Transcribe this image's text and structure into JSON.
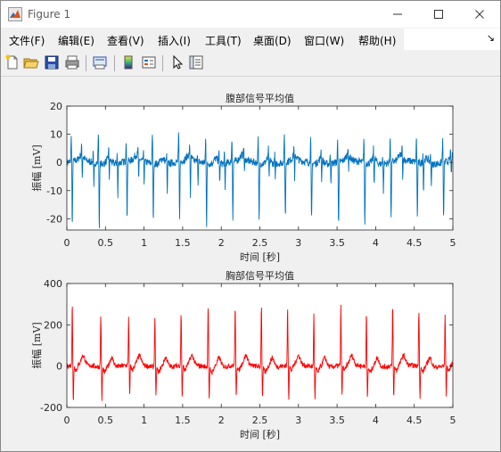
{
  "window": {
    "title": "Figure 1"
  },
  "menu": {
    "items": [
      "文件(F)",
      "编辑(E)",
      "查看(V)",
      "插入(I)",
      "工具(T)",
      "桌面(D)",
      "窗口(W)",
      "帮助(H)"
    ],
    "overflow_icon": "arrow-corner-icon"
  },
  "toolbar": {
    "icons": [
      "new-figure-icon",
      "open-file-icon",
      "save-icon",
      "print-icon",
      "print-preview-icon",
      "colorbar-icon",
      "legend-icon",
      "pointer-icon",
      "property-inspector-icon"
    ]
  },
  "colors": {
    "abdominal_line": "#0072bd",
    "thoracic_line": "#ff0000",
    "axes_bg": "#ffffff",
    "axis_text": "#262626"
  },
  "chart_data": [
    {
      "type": "line",
      "title": "腹部信号平均值",
      "xlabel": "时间 [秒]",
      "ylabel": "振幅 [mV]",
      "xlim": [
        0,
        5
      ],
      "ylim": [
        -24,
        20
      ],
      "xticks": [
        "0",
        "0.5",
        "1",
        "1.5",
        "2",
        "2.5",
        "3",
        "3.5",
        "4",
        "4.5",
        "5"
      ],
      "yticks": [
        "-20",
        "-10",
        "0",
        "10",
        "20"
      ],
      "grid": false,
      "series": [
        {
          "color": "#0072bd",
          "baseline": 0,
          "noise_amplitude": 1.3,
          "beats_sharp": [
            0.07,
            0.42,
            0.78,
            1.12,
            1.46,
            1.81,
            2.15,
            2.49,
            2.83,
            3.17,
            3.52,
            3.86,
            4.2,
            4.54,
            4.88
          ],
          "beats_sharp_peak": [
            -24,
            -23,
            -20,
            -20,
            -20,
            -22,
            -20,
            -21,
            -20,
            -21,
            -22,
            -23,
            -21,
            -20,
            -21
          ],
          "beats_sharp_up": [
            9,
            11,
            8,
            11,
            10,
            9,
            8,
            9,
            10,
            9,
            8,
            9,
            10,
            9,
            8
          ],
          "beats_fetal": [
            0.2,
            0.35,
            0.55,
            0.66,
            0.93,
            1.0,
            1.3,
            1.6,
            1.7,
            1.98,
            2.05,
            2.3,
            2.62,
            2.7,
            2.95,
            3.3,
            3.42,
            3.65,
            3.98,
            4.1,
            4.35,
            4.62,
            4.72,
            4.98
          ],
          "beats_fetal_peak": [
            -8,
            -10,
            -7,
            -13,
            -9,
            -8,
            -12,
            -15,
            -9,
            -7,
            -10,
            -6,
            -8,
            -6,
            -10,
            -8,
            -7,
            -6,
            -9,
            -11,
            -7,
            -11,
            -8,
            -8
          ]
        }
      ]
    },
    {
      "type": "line",
      "title": "胸部信号平均值",
      "xlabel": "时间 [秒]",
      "ylabel": "振幅 [mV]",
      "xlim": [
        0,
        5
      ],
      "ylim": [
        -200,
        400
      ],
      "xticks": [
        "0",
        "0.5",
        "1",
        "1.5",
        "2",
        "2.5",
        "3",
        "3.5",
        "4",
        "4.5",
        "5"
      ],
      "yticks": [
        "-200",
        "0",
        "200",
        "400"
      ],
      "grid": false,
      "series": [
        {
          "color": "#ff0000",
          "baseline": 0,
          "noise_amplitude": 12,
          "beats": [
            0.07,
            0.44,
            0.8,
            1.14,
            1.48,
            1.83,
            2.18,
            2.52,
            2.86,
            3.2,
            3.55,
            3.88,
            4.22,
            4.56,
            4.9
          ],
          "peak_up": [
            310,
            250,
            240,
            250,
            250,
            300,
            290,
            300,
            285,
            255,
            285,
            270,
            300,
            275,
            250
          ],
          "peak_down": [
            -185,
            -160,
            -150,
            -150,
            -155,
            -160,
            -160,
            -155,
            -160,
            -150,
            -150,
            -155,
            -160,
            -150,
            -140
          ]
        }
      ]
    }
  ]
}
